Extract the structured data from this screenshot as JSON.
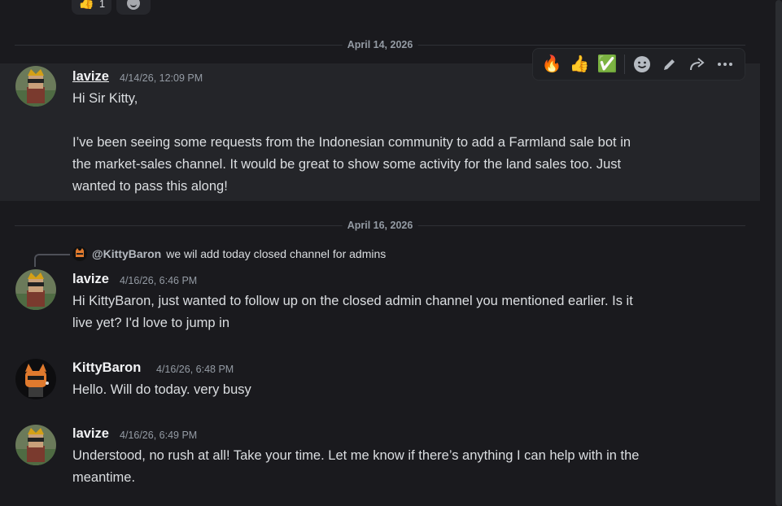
{
  "reactions_prev": [
    {
      "emoji": "👍",
      "count": "1"
    }
  ],
  "dividers": [
    {
      "label": "April 14, 2026"
    },
    {
      "label": "April 16, 2026"
    }
  ],
  "toolbar": {
    "quick_reactions": [
      "🔥",
      "👍",
      "✅"
    ],
    "icons": [
      "add-reaction-icon",
      "pencil-edit-icon",
      "forward-arrow-icon",
      "more-ellipsis-icon"
    ]
  },
  "messages": [
    {
      "username": "lavize",
      "timestamp": "4/14/26, 12:09 PM",
      "lines": [
        "Hi Sir Kitty,",
        "",
        "I’ve been seeing some requests from the Indonesian community to add a Farmland sale bot in",
        "the market-sales channel. It would be great to show some activity for the land sales too. Just",
        "wanted to pass this along!"
      ]
    },
    {
      "reply": {
        "name": "@KittyBaron",
        "text": "we wil add today closed channel for admins"
      },
      "username": "lavize",
      "timestamp": "4/16/26, 6:46 PM",
      "lines": [
        "Hi KittyBaron, just wanted to follow up on the closed admin channel you mentioned earlier. Is it",
        "live yet? I'd love to jump in"
      ]
    },
    {
      "username": "KittyBaron",
      "timestamp": "4/16/26, 6:48 PM",
      "lines": [
        "Hello. Will do today. very busy"
      ]
    },
    {
      "username": "lavize",
      "timestamp": "4/16/26, 6:49 PM",
      "lines": [
        "Understood, no rush at all! Take your time. Let me know if there’s anything I can help with in the",
        "meantime."
      ]
    }
  ],
  "colors": {
    "background": "#1a1a1e",
    "hover_background": "#242529",
    "text": "#dbdee1",
    "muted": "#949ba4"
  }
}
